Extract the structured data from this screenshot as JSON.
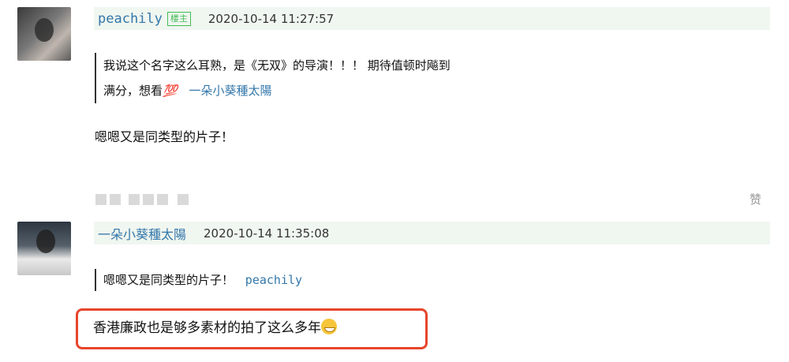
{
  "comments": [
    {
      "username": "peachily",
      "badge": "楼主",
      "timestamp": "2020-10-14 11:27:57",
      "quote_line1": "我说这个名字这么耳熟，是《无双》的导演！！！ 期待值顿时飚到",
      "quote_line2_prefix": "满分，想看",
      "quote_emoji": "💯",
      "quote_author": "一朵小葵種太陽",
      "reply": "嗯嗯又是同类型的片子！",
      "like_label": "赞",
      "avatar_icon": "avatar-peachily"
    },
    {
      "username": "一朵小葵種太陽",
      "timestamp": "2020-10-14 11:35:08",
      "quote_text": "嗯嗯又是同类型的片子！",
      "quote_author": "peachily",
      "reply": "香港廉政也是够多素材的拍了这么多年",
      "reply_emoji": "grinning-sweat-emoji",
      "avatar_icon": "avatar-sunflower"
    }
  ],
  "highlight_color": "#e8452c",
  "link_color": "#3377aa",
  "badge_color": "#42bd56"
}
